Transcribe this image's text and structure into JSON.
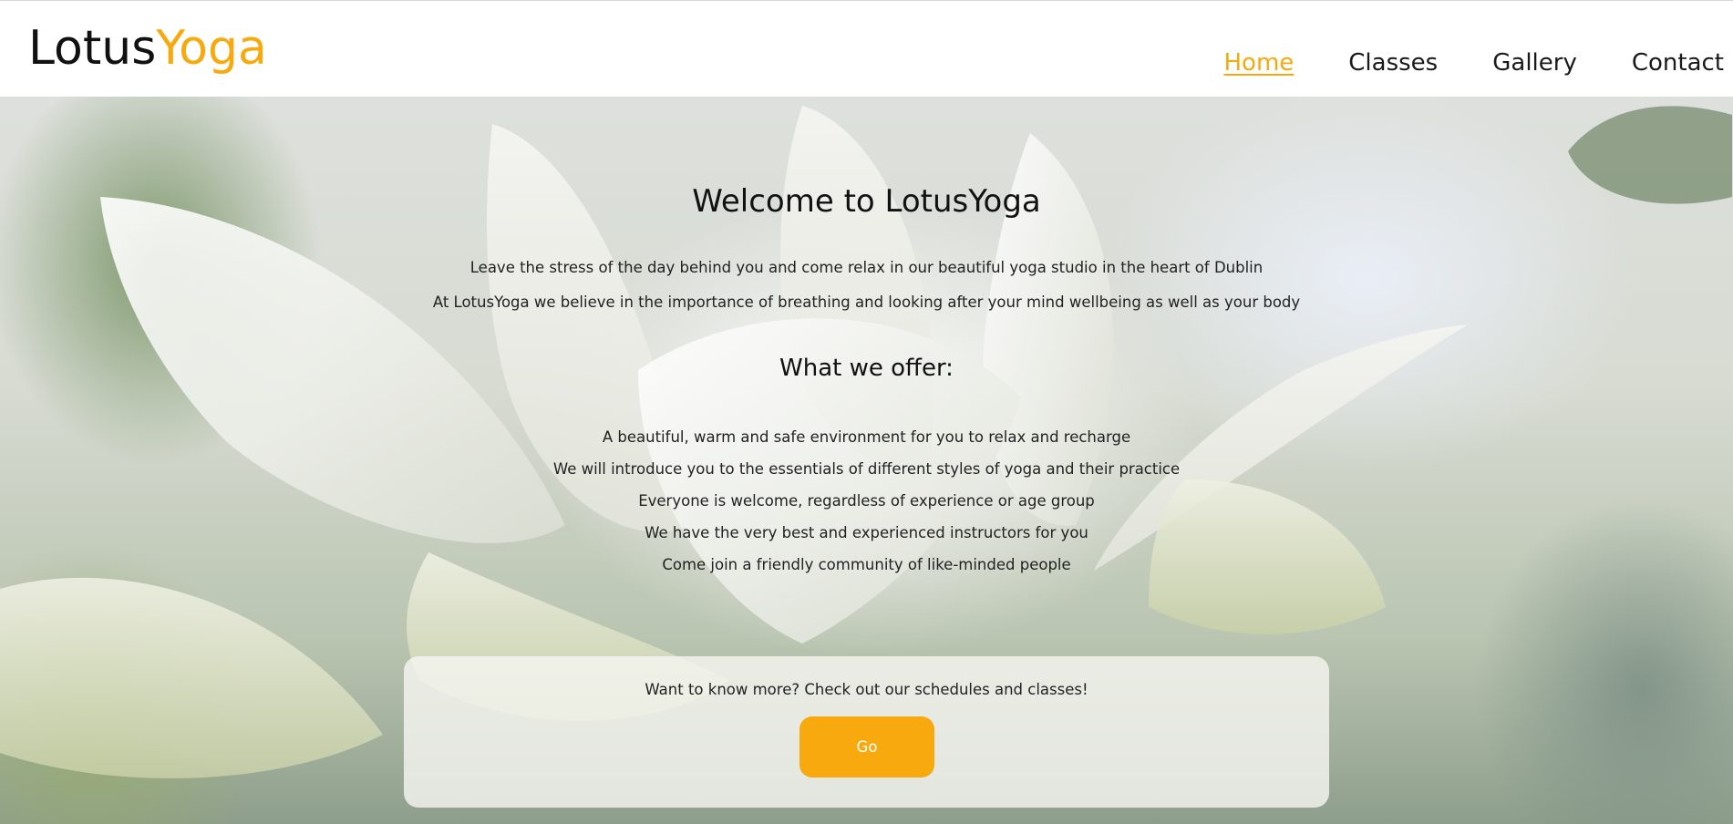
{
  "header": {
    "logo_part_1": "Lotus",
    "logo_part_2": "Yoga"
  },
  "nav": {
    "items": [
      {
        "label": "Home",
        "active": true
      },
      {
        "label": "Classes",
        "active": false
      },
      {
        "label": "Gallery",
        "active": false
      },
      {
        "label": "Contact",
        "active": false
      }
    ]
  },
  "hero": {
    "title": "Welcome to LotusYoga",
    "paragraphs": [
      "Leave the stress of the day behind you and come relax in our beautiful yoga studio in the heart of Dublin",
      "At LotusYoga we believe in the importance of breathing and looking after your mind wellbeing as well as your body"
    ],
    "offer_heading": "What we offer:",
    "offers": [
      "A beautiful, warm and safe environment for you to relax and recharge",
      "We will introduce you to the essentials of different styles of yoga and their practice",
      "Everyone is welcome, regardless of experience or age group",
      "We have the very best and experienced instructors for you",
      "Come join a friendly community of like-minded people"
    ]
  },
  "cta": {
    "text": "Want to know more? Check out our schedules and classes!",
    "button_label": "Go"
  },
  "colors": {
    "accent": "#f7a90e",
    "text": "#1a1a1a",
    "header_bg": "#ffffff"
  }
}
